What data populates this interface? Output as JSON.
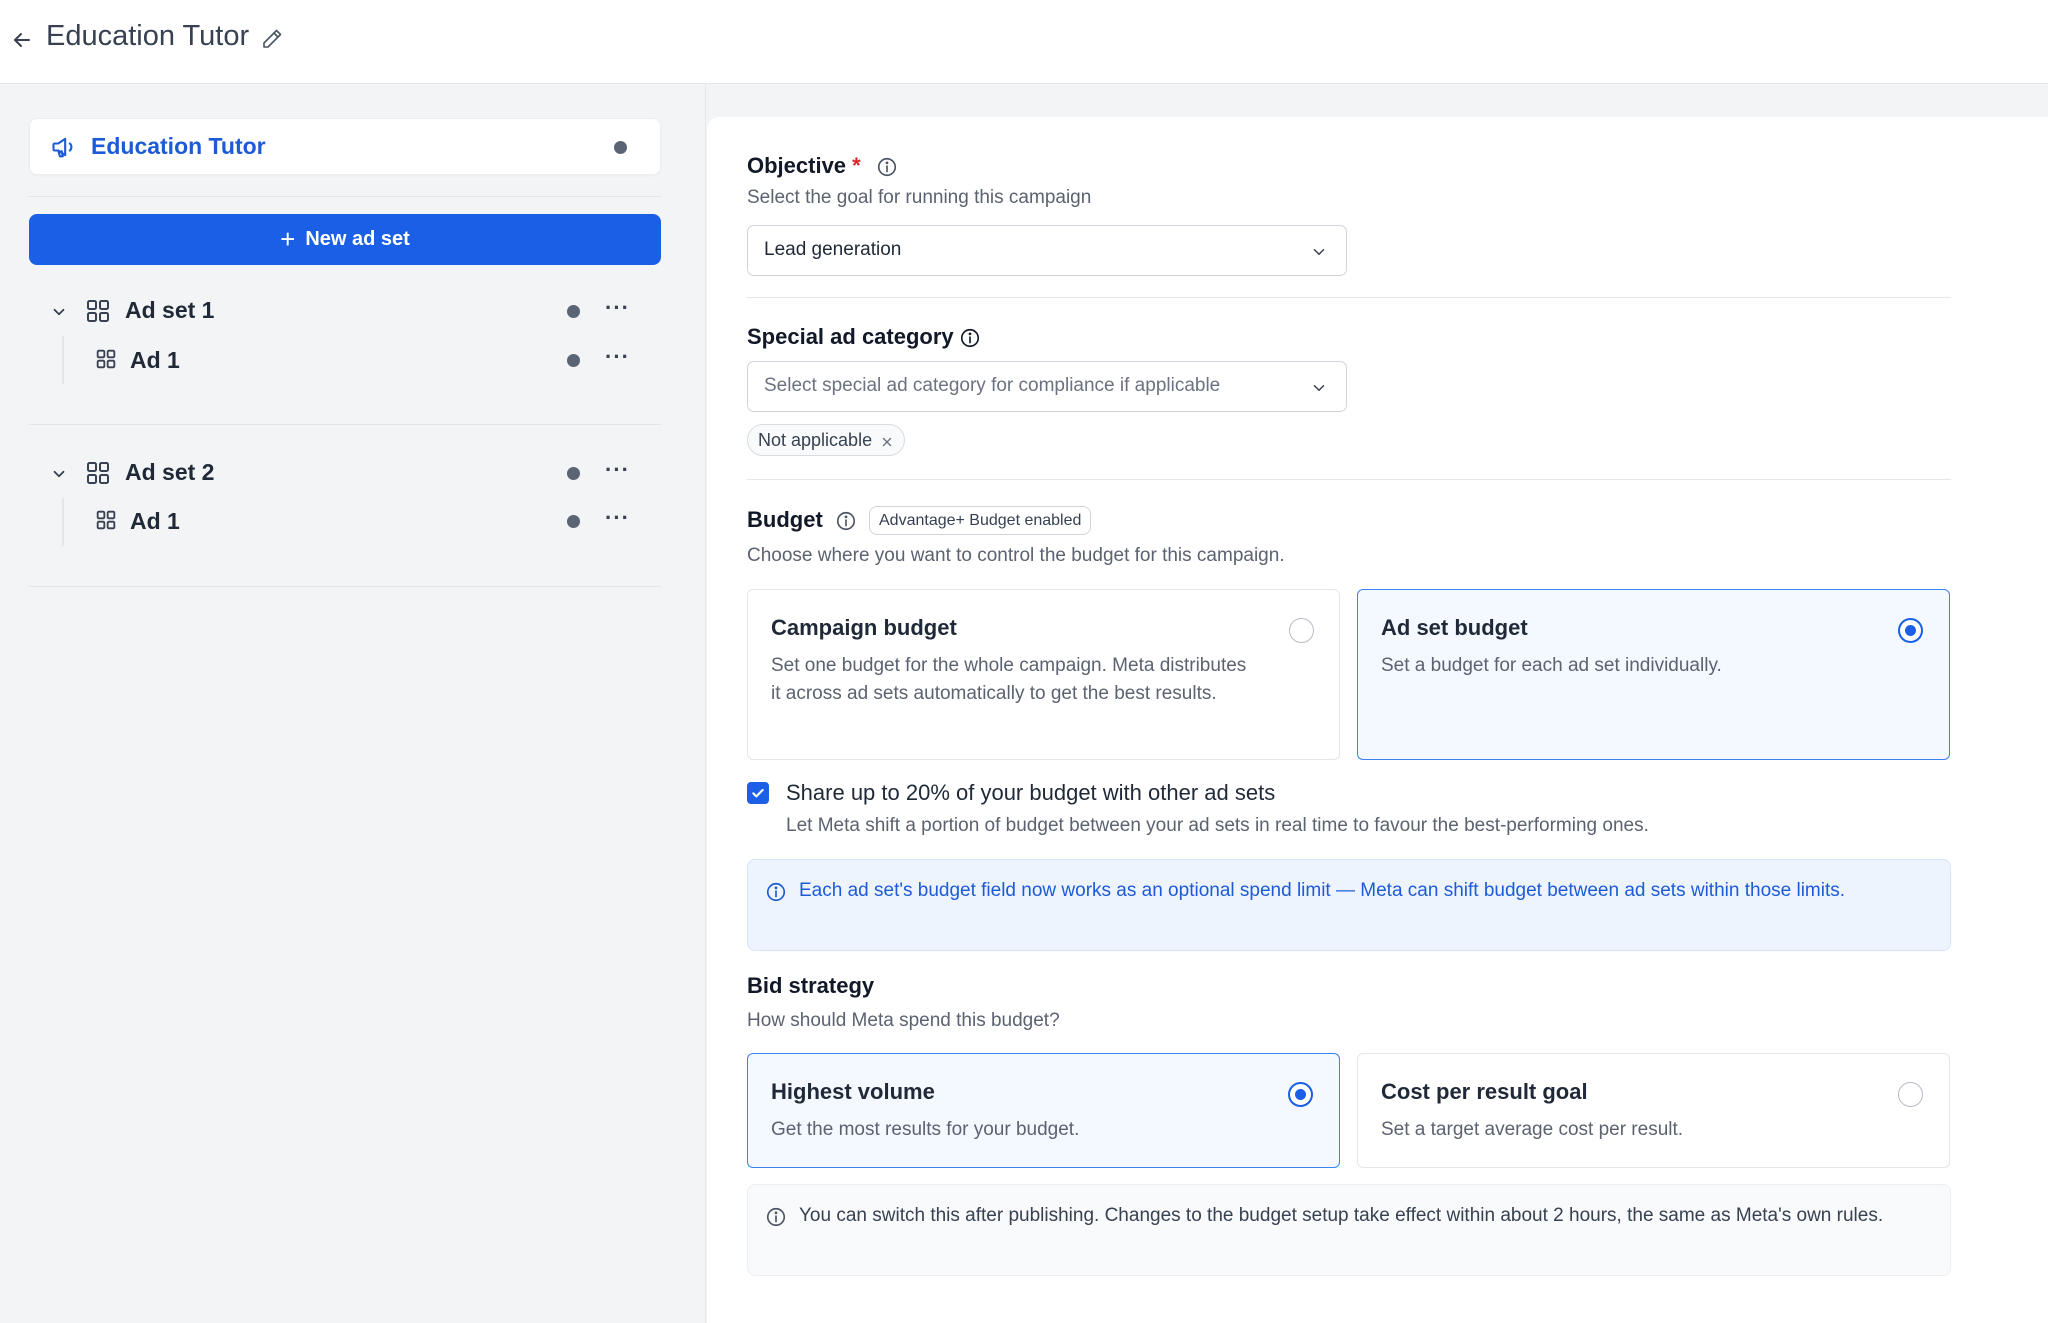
{
  "header": {
    "title": "Education Tutor"
  },
  "sidebar": {
    "campaign": {
      "name": "Education Tutor"
    },
    "new_ad_set_label": "New ad set",
    "ad_sets": [
      {
        "label": "Ad set 1",
        "ads": [
          {
            "label": "Ad 1"
          }
        ]
      },
      {
        "label": "Ad set 2",
        "ads": [
          {
            "label": "Ad 1"
          }
        ]
      }
    ],
    "more_glyph": "···"
  },
  "objective": {
    "label": "Objective",
    "required_mark": "*",
    "helper": "Select the goal for running this campaign",
    "selected": "Lead generation"
  },
  "special_category": {
    "label": "Special ad category",
    "placeholder": "Select special ad category for compliance if applicable",
    "chips": [
      "Not applicable"
    ]
  },
  "budget": {
    "label": "Budget",
    "badge": "Advantage+ Budget enabled",
    "helper": "Choose where you want to control the budget for this campaign.",
    "options": [
      {
        "title": "Campaign budget",
        "description": "Set one budget for the whole campaign. Meta distributes it across ad sets automatically to get the best results.",
        "selected": false
      },
      {
        "title": "Ad set budget",
        "description": "Set a budget for each ad set individually.",
        "selected": true
      }
    ],
    "share": {
      "checked": true,
      "label": "Share up to 20% of your budget with other ad sets",
      "description": "Let Meta shift a portion of budget between your ad sets in real time to favour the best-performing ones."
    },
    "info_note": "Each ad set's budget field now works as an optional spend limit — Meta can shift budget between ad sets within those limits."
  },
  "bid_strategy": {
    "label": "Bid strategy",
    "helper": "How should Meta spend this budget?",
    "options": [
      {
        "title": "Highest volume",
        "description": "Get the most results for your budget.",
        "selected": true
      },
      {
        "title": "Cost per result goal",
        "description": "Set a target average cost per result.",
        "selected": false
      }
    ],
    "note": "You can switch this after publishing. Changes to the budget setup take effect within about 2 hours, the same as Meta's own rules."
  },
  "colors": {
    "accent": "#1a5fe6",
    "link": "#1d5bd6",
    "required": "#dc2626"
  }
}
